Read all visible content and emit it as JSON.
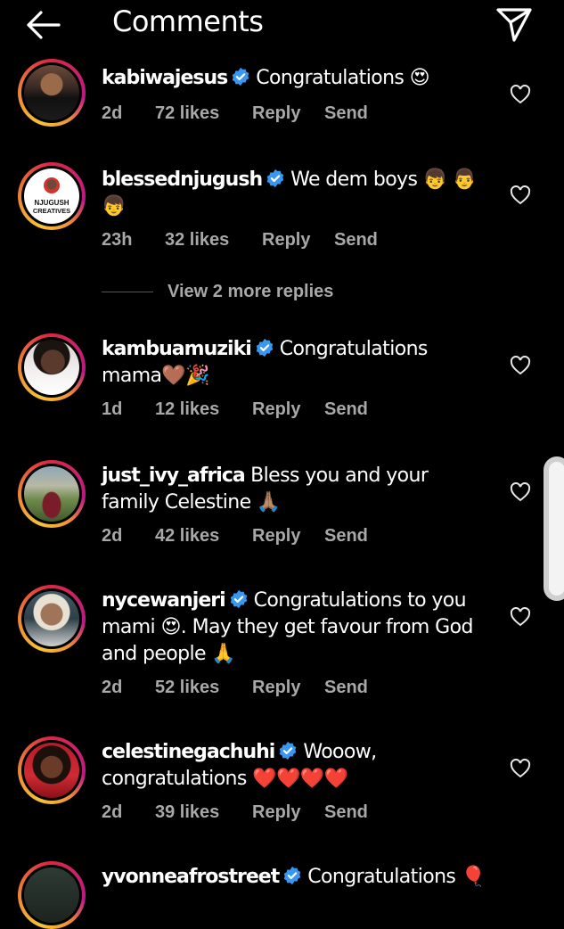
{
  "header": {
    "title": "Comments"
  },
  "comments": [
    {
      "username": "kabiwajesus",
      "verified": true,
      "text": "Congratulations 😍",
      "time": "2d",
      "likes": "72 likes",
      "reply": "Reply",
      "send": "Send"
    },
    {
      "username": "blessednjugush",
      "verified": true,
      "text": "We dem boys 👦 👨",
      "text2": "👦",
      "time": "23h",
      "likes": "32 likes",
      "reply": "Reply",
      "send": "Send",
      "avatar_text_1": "NJUGUSH",
      "avatar_text_2": "CREATIVES"
    },
    {
      "username": "kambuamuziki",
      "verified": true,
      "text": "Congratulations",
      "text2": "mama🤎🎉",
      "time": "1d",
      "likes": "12 likes",
      "reply": "Reply",
      "send": "Send"
    },
    {
      "username": "just_ivy_africa",
      "verified": false,
      "text": "Bless you and your",
      "text2": "family Celestine 🙏🏽",
      "time": "2d",
      "likes": "42 likes",
      "reply": "Reply",
      "send": "Send"
    },
    {
      "username": "nycewanjeri",
      "verified": true,
      "text": "Congratulations to you",
      "text2": "mami 😍. May they get favour from God",
      "text3": "and people 🙏",
      "time": "2d",
      "likes": "52 likes",
      "reply": "Reply",
      "send": "Send"
    },
    {
      "username": "celestinegachuhi",
      "verified": true,
      "text": "Wooow,",
      "text2": "congratulations ❤️❤️❤️❤️",
      "time": "2d",
      "likes": "39 likes",
      "reply": "Reply",
      "send": "Send"
    },
    {
      "username": "yvonneafrostreet",
      "verified": true,
      "text": "Congratulations 🎈"
    }
  ],
  "view_replies": "View 2 more replies",
  "colors": {
    "background": "#000000",
    "meta_text": "#a8a8a8",
    "verified_blue": "#3897f0"
  },
  "icons": [
    "back-arrow-icon",
    "send-icon",
    "verified-badge-icon",
    "heart-icon"
  ]
}
